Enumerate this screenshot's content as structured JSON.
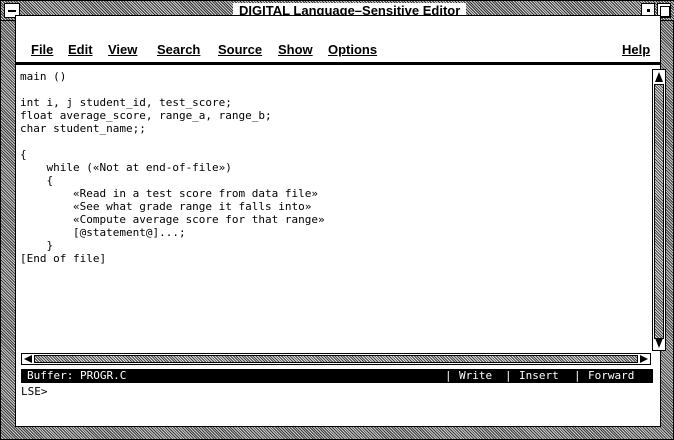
{
  "window": {
    "title": "DIGITAL Language–Sensitive Editor"
  },
  "menu": {
    "items": [
      {
        "label": "File",
        "name": "menu-file"
      },
      {
        "label": "Edit",
        "name": "menu-edit"
      },
      {
        "label": "View",
        "name": "menu-view"
      },
      {
        "label": "Search",
        "name": "menu-search"
      },
      {
        "label": "Source",
        "name": "menu-source"
      },
      {
        "label": "Show",
        "name": "menu-show"
      },
      {
        "label": "Options",
        "name": "menu-options"
      }
    ],
    "help": "Help"
  },
  "editor": {
    "lines": [
      "main ()",
      "",
      "int i, j student_id, test_score;",
      "float average_score, range_a, range_b;",
      "char student_name;;",
      "",
      "{",
      "    while («Not at end-of-file»)",
      "    {",
      "        «Read in a test score from data file»",
      "        «See what grade range it falls into»",
      "        «Compute average score for that range»",
      "        [@statement@]...;",
      "    }",
      "[End of file]"
    ]
  },
  "status": {
    "buffer": "Buffer: PROGR.C",
    "mode_write": "Write",
    "mode_insert": "Insert",
    "mode_direction": "Forward",
    "sep": "|"
  },
  "command": {
    "prompt": "LSE>"
  }
}
